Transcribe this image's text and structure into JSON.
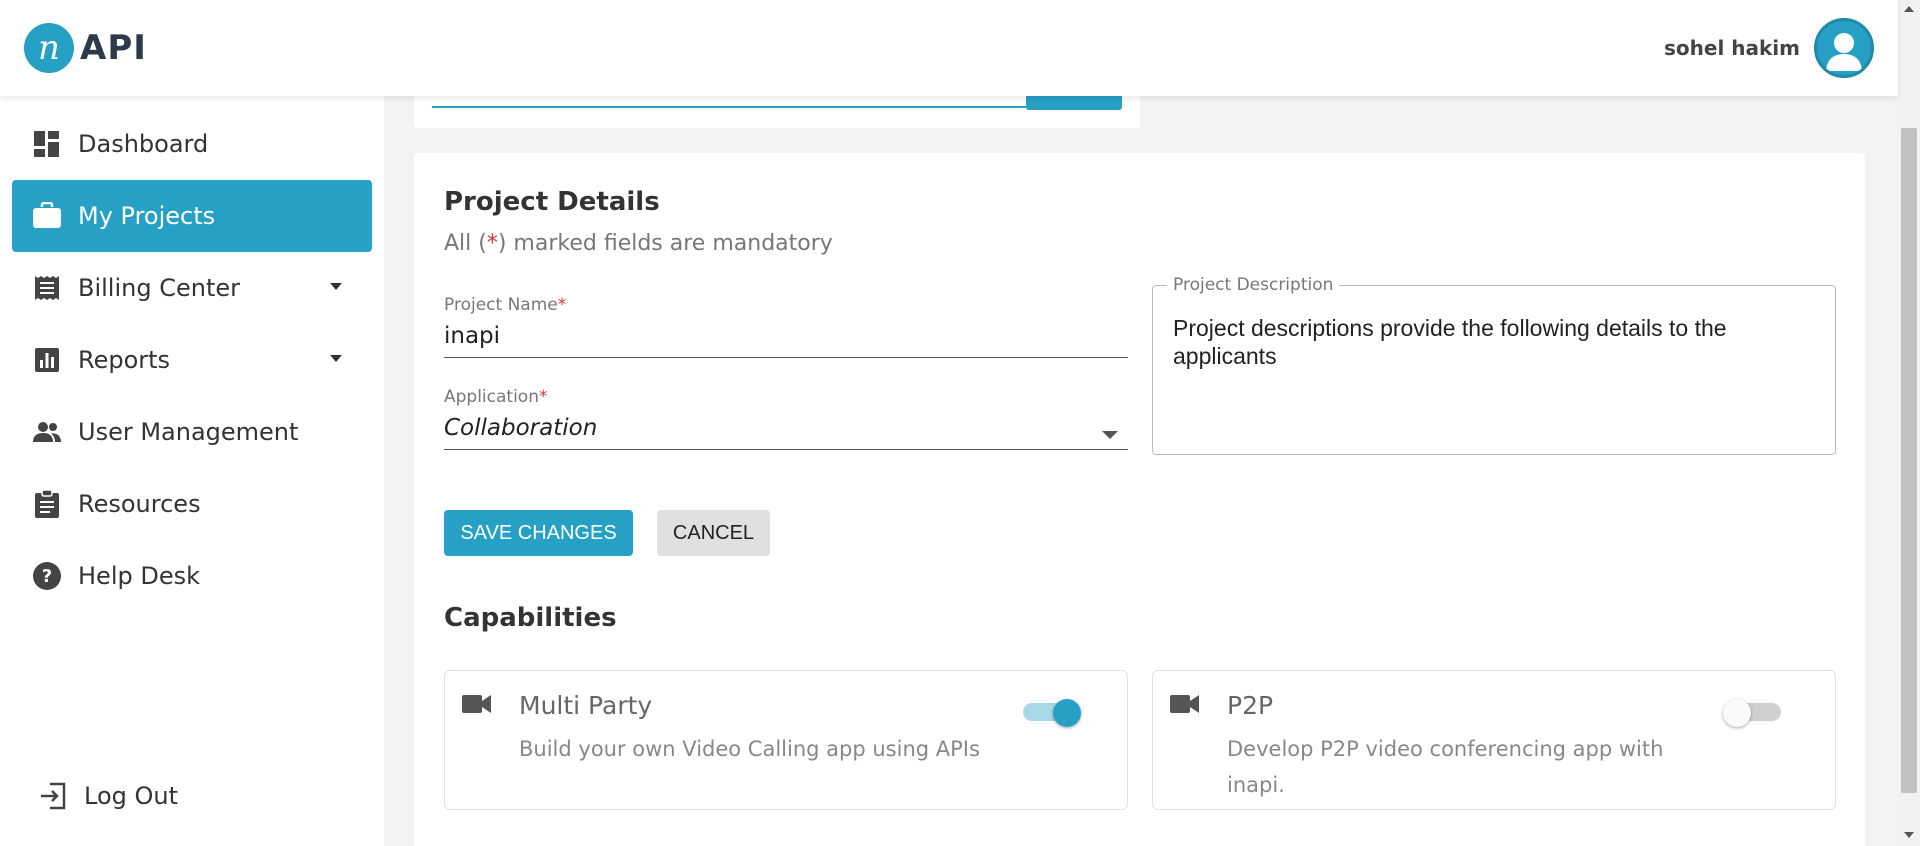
{
  "header": {
    "brand_logo_letter": "n",
    "brand_text": "API",
    "user_name": "sohel hakim"
  },
  "sidebar": {
    "items": [
      {
        "label": "Dashboard",
        "icon": "dashboard-icon"
      },
      {
        "label": "My Projects",
        "icon": "briefcase-icon",
        "active": true
      },
      {
        "label": "Billing Center",
        "icon": "receipt-icon",
        "has_caret": true
      },
      {
        "label": "Reports",
        "icon": "bar-chart-icon",
        "has_caret": true
      },
      {
        "label": "User Management",
        "icon": "people-icon"
      },
      {
        "label": "Resources",
        "icon": "clipboard-icon"
      },
      {
        "label": "Help Desk",
        "icon": "help-icon"
      }
    ],
    "logout_label": "Log Out"
  },
  "project": {
    "title": "Project Details",
    "note_prefix": "All (",
    "note_star": "*",
    "note_suffix": ") marked fields are mandatory",
    "name_label": "Project Name",
    "name_value": "inapi",
    "application_label": "Application",
    "application_value": "Collaboration",
    "description_label": "Project Description",
    "description_value": "Project descriptions provide the following details to the applicants",
    "required_mark": "*"
  },
  "actions": {
    "save_label": "SAVE CHANGES",
    "cancel_label": "CANCEL"
  },
  "capabilities": {
    "title": "Capabilities",
    "items": [
      {
        "name": "Multi Party",
        "description": "Build your own Video Calling app using APIs",
        "enabled": true
      },
      {
        "name": "P2P",
        "description": "Develop P2P video conferencing app with inapi.",
        "enabled": false
      }
    ]
  },
  "colors": {
    "accent": "#26a0c4",
    "required": "#d9363e"
  }
}
